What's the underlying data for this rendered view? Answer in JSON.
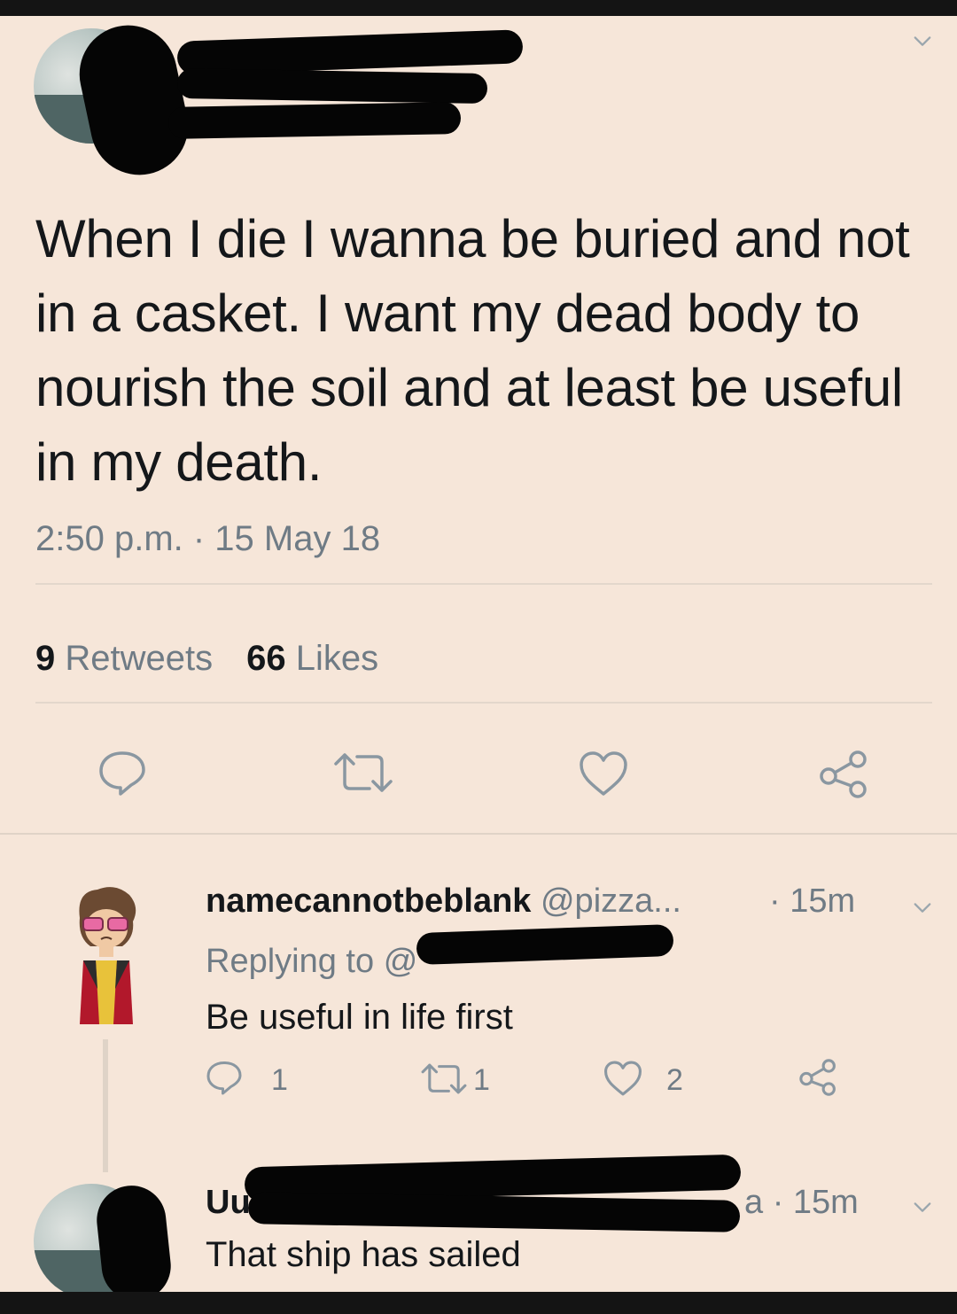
{
  "tweet": {
    "text": "When I die I wanna be buried and not in a casket. I want my dead body to nourish the soil and at least be useful in my death.",
    "time": "2:50 p.m. · 15 May 18",
    "retweets_count": "9",
    "retweets_label": "Retweets",
    "likes_count": "66",
    "likes_label": "Likes"
  },
  "reply1": {
    "name": "namecannotbeblank",
    "handle": "@pizza...",
    "time": "· 15m",
    "replying_to": "Replying to",
    "replying_at": "@",
    "text": "Be useful in life first",
    "reply_count": "1",
    "retweet_count": "1",
    "like_count": "2"
  },
  "reply2": {
    "name_start": "Uu",
    "time": "a · 15m",
    "text": "That ship has sailed"
  },
  "icons": {
    "reply": "reply-icon",
    "retweet": "retweet-icon",
    "like": "heart-icon",
    "share": "share-icon",
    "menu": "chevron-down-icon"
  },
  "colors": {
    "background": "#f6e6d9",
    "text": "#14171a",
    "muted": "#6f7b85",
    "icon": "#8a97a1"
  }
}
